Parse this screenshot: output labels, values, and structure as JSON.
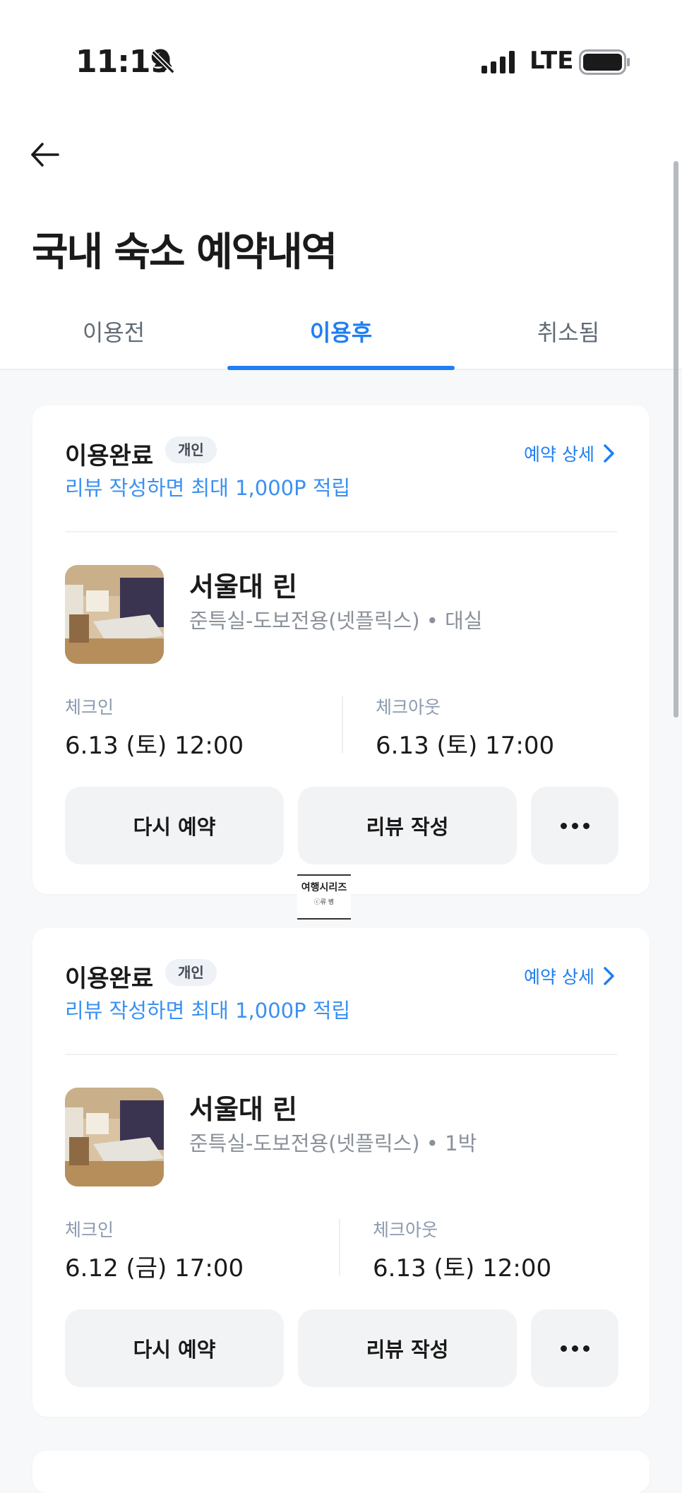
{
  "status_bar": {
    "time": "11:19",
    "network": "LTE"
  },
  "header": {
    "title": "국내 숙소 예약내역"
  },
  "tabs": [
    {
      "label": "이용전"
    },
    {
      "label": "이용후"
    },
    {
      "label": "취소됨"
    }
  ],
  "bookings": [
    {
      "status": "이용완료",
      "badge": "개인",
      "detail_link": "예약 상세",
      "promo": "리뷰 작성하면 최대 1,000P 적립",
      "hotel_name": "서울대 린",
      "room_info": "준특실-도보전용(넷플릭스) • 대실",
      "checkin_label": "체크인",
      "checkin_value": "6.13 (토) 12:00",
      "checkout_label": "체크아웃",
      "checkout_value": "6.13 (토) 17:00",
      "rebook_label": "다시 예약",
      "review_label": "리뷰 작성"
    },
    {
      "status": "이용완료",
      "badge": "개인",
      "detail_link": "예약 상세",
      "promo": "리뷰 작성하면 최대 1,000P 적립",
      "hotel_name": "서울대 린",
      "room_info": "준특실-도보전용(넷플릭스) • 1박",
      "checkin_label": "체크인",
      "checkin_value": "6.12 (금) 17:00",
      "checkout_label": "체크아웃",
      "checkout_value": "6.13 (토) 12:00",
      "rebook_label": "다시 예약",
      "review_label": "리뷰 작성"
    }
  ],
  "watermark": {
    "line1": "여행시리즈",
    "line2": "ⓒ류 병"
  },
  "colors": {
    "accent": "#1f7ff2",
    "promo": "#3a90f2",
    "card_bg": "#ffffff",
    "page_bg": "#f7f8f9"
  },
  "icons": [
    "bell-slash-icon",
    "signal-icon",
    "battery-icon",
    "back-arrow-icon",
    "chevron-right-icon",
    "more-dots-icon"
  ]
}
